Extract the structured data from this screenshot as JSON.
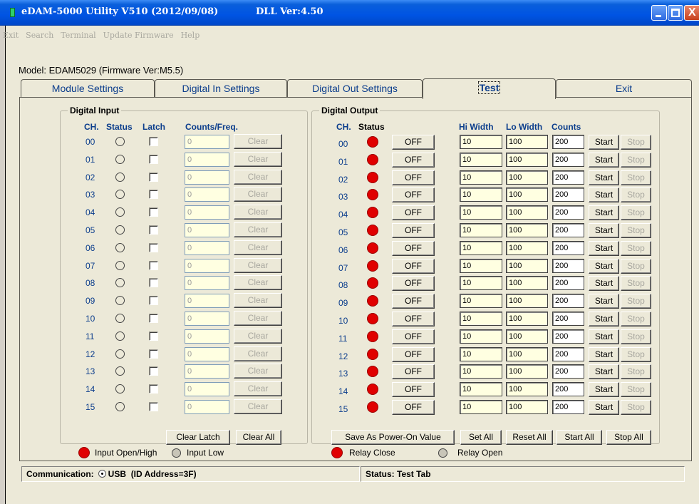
{
  "window": {
    "title": "eDAM-5000 Utility  V510 (2012/09/08)",
    "dll_version": "DLL Ver:4.50",
    "close_glyph": "X"
  },
  "menu": [
    "Exit",
    "Search",
    "Terminal",
    "Update Firmware",
    "Help"
  ],
  "model_label": "Model: EDAM5029 (Firmware Ver:M5.5)",
  "tabs": [
    "Module Settings",
    "Digital In Settings",
    "Digital Out Settings",
    "Test",
    "Exit"
  ],
  "active_tab": "Test",
  "digital_input": {
    "title": "Digital Input",
    "headers": {
      "ch": "CH.",
      "status": "Status",
      "latch": "Latch",
      "counts": "Counts/Freq."
    },
    "channels": [
      "00",
      "01",
      "02",
      "03",
      "04",
      "05",
      "06",
      "07",
      "08",
      "09",
      "10",
      "11",
      "12",
      "13",
      "14",
      "15"
    ],
    "count_value": "0",
    "clear_label": "Clear",
    "clear_latch_label": "Clear Latch",
    "clear_all_label": "Clear All",
    "legend_high": "Input Open/High",
    "legend_low": "Input Low",
    "colors": {
      "high": "#e00000",
      "low": "#ece9d8"
    }
  },
  "digital_output": {
    "title": "Digital Output",
    "headers": {
      "ch": "CH.",
      "status": "Status",
      "hi_width": "Hi Width",
      "lo_width": "Lo Width",
      "counts": "Counts"
    },
    "channels": [
      "00",
      "01",
      "02",
      "03",
      "04",
      "05",
      "06",
      "07",
      "08",
      "09",
      "10",
      "11",
      "12",
      "13",
      "14",
      "15"
    ],
    "off_label": "OFF",
    "hi_width_value": "10",
    "lo_width_value": "100",
    "counts_value": "200",
    "start_label": "Start",
    "stop_label": "Stop",
    "save_label": "Save As Power-On Value",
    "set_all_label": "Set All",
    "reset_all_label": "Reset All",
    "start_all_label": "Start All",
    "stop_all_label": "Stop All",
    "legend_close": "Relay Close",
    "legend_open": "Relay Open",
    "colors": {
      "relay_close": "#e00000"
    }
  },
  "statusbar": {
    "communication_label": "Communication:",
    "usb_label": "USB",
    "id_address": "(ID Address=3F)",
    "status": "Status: Test Tab"
  }
}
